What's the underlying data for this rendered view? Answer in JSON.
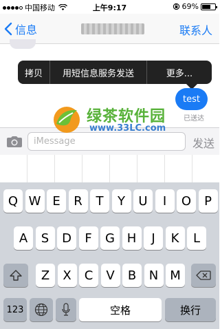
{
  "status_bar": {
    "carrier": "中国移动",
    "time": "上午9:17",
    "battery_text": "69%",
    "battery_level": 0.69,
    "icons": [
      "signal-icon",
      "wifi-icon",
      "lock-rotation-icon",
      "battery-icon"
    ]
  },
  "nav": {
    "back_label": "信息",
    "contacts_label": "联系人"
  },
  "popup_menu": {
    "items": [
      "拷贝",
      "用短信息服务发送",
      "更多..."
    ]
  },
  "messages": {
    "outgoing_text": "test",
    "status": "已送达"
  },
  "watermark": {
    "title": "绿茶软件园",
    "url": "www.33LC.com"
  },
  "input": {
    "placeholder": "iMessage",
    "send_label": "发送"
  },
  "keyboard": {
    "row1": [
      "Q",
      "W",
      "E",
      "R",
      "T",
      "Y",
      "U",
      "I",
      "O",
      "P"
    ],
    "row2": [
      "A",
      "S",
      "D",
      "F",
      "G",
      "H",
      "J",
      "K",
      "L"
    ],
    "row3": [
      "Z",
      "X",
      "C",
      "V",
      "B",
      "N",
      "M"
    ],
    "numbers_label": "123",
    "space_label": "空格",
    "return_label": "换行"
  },
  "colors": {
    "accent": "#1a7bf5",
    "popup_bg": "#222222",
    "bubble_out": "#1a7bf5",
    "keyboard_bg": "#d1d5db"
  }
}
